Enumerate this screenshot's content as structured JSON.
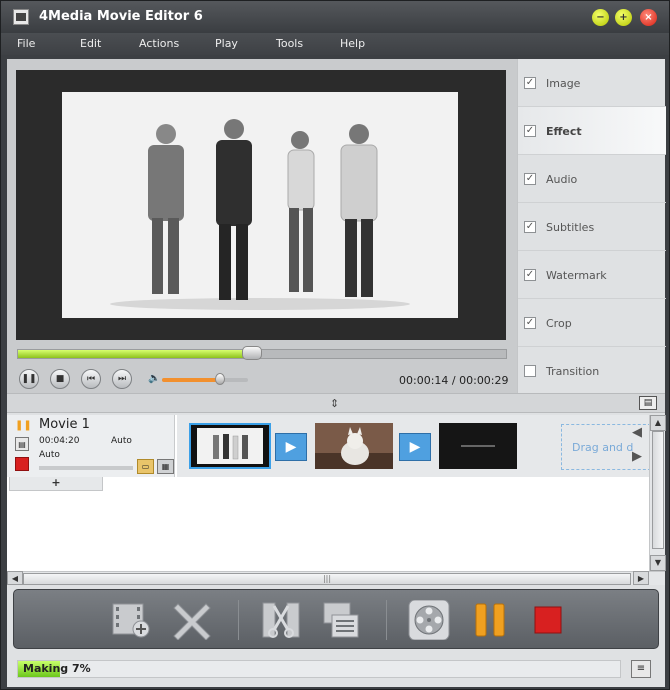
{
  "app": {
    "title": "4Media Movie Editor 6"
  },
  "window_controls": {
    "minimize": "−",
    "maximize": "+",
    "close": "×"
  },
  "menu": [
    "File",
    "Edit",
    "Actions",
    "Play",
    "Tools",
    "Help"
  ],
  "player": {
    "current_time": "00:00:14",
    "total_time": "00:00:29",
    "time_separator": " / ",
    "playback_progress": 0.48,
    "volume": 0.67,
    "controls": {
      "pause": "❚❚",
      "stop": "■",
      "previous": "⏮",
      "next": "⏭",
      "speaker": "🔈"
    }
  },
  "side_panel": {
    "items": [
      {
        "label": "Image",
        "checked": true
      },
      {
        "label": "Effect",
        "checked": true,
        "selected": true
      },
      {
        "label": "Audio",
        "checked": true
      },
      {
        "label": "Subtitles",
        "checked": true
      },
      {
        "label": "Watermark",
        "checked": true
      },
      {
        "label": "Crop",
        "checked": true
      },
      {
        "label": "Transition",
        "checked": false
      }
    ]
  },
  "splitter": {
    "arrow": "⇕",
    "export_icon": "▤"
  },
  "movie": {
    "title": "Movie 1",
    "duration": "00:04:20",
    "mode1": "Auto",
    "mode2": "Auto",
    "add_label": "+"
  },
  "timeline": {
    "drag_hint": "Drag and d",
    "transition_glyph": "▶",
    "clips": [
      {
        "kind": "people",
        "selected": true
      },
      {
        "kind": "cat",
        "selected": false
      },
      {
        "kind": "dark",
        "selected": false
      }
    ],
    "nav_left": "◀",
    "nav_right": "▶"
  },
  "scroll": {
    "up": "▲",
    "down": "▼",
    "left": "◀",
    "right": "▶",
    "grip": "|||"
  },
  "toolbar": {
    "buttons": [
      "add-video-icon",
      "delete-icon",
      "cut-icon",
      "merge-icon",
      "convert-icon",
      "pause-icon",
      "stop-icon"
    ]
  },
  "status": {
    "text": "Making 7%",
    "progress": 0.07,
    "log_icon": "≡"
  },
  "colors": {
    "accent_green": "#8ec21c",
    "titlebar": "#3a3d41",
    "pause_orange": "#f0a020",
    "stop_red": "#d82020",
    "transition_blue": "#4fa0e0",
    "volume_orange": "#f2902e"
  }
}
